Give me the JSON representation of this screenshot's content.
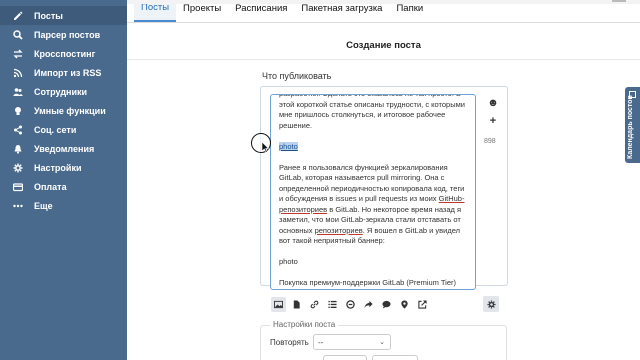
{
  "sidebar": {
    "items": [
      {
        "label": "Посты",
        "icon": "edit-icon",
        "active": true
      },
      {
        "label": "Парсер постов",
        "icon": "search-icon",
        "active": false
      },
      {
        "label": "Кросспостинг",
        "icon": "exchange-icon",
        "active": false
      },
      {
        "label": "Импорт из RSS",
        "icon": "rss-icon",
        "active": false
      },
      {
        "label": "Сотрудники",
        "icon": "users-icon",
        "active": false
      },
      {
        "label": "Умные функции",
        "icon": "bulb-icon",
        "active": false
      },
      {
        "label": "Соц. сети",
        "icon": "share-icon",
        "active": false
      },
      {
        "label": "Уведомления",
        "icon": "bell-icon",
        "active": false
      },
      {
        "label": "Настройки",
        "icon": "gear-icon",
        "active": false
      },
      {
        "label": "Оплата",
        "icon": "card-icon",
        "active": false
      },
      {
        "label": "Еще",
        "icon": "more-icon",
        "active": false
      }
    ]
  },
  "tabs": [
    {
      "label": "Посты",
      "active": true
    },
    {
      "label": "Проекты",
      "active": false
    },
    {
      "label": "Расписания",
      "active": false
    },
    {
      "label": "Пакетная загрузка",
      "active": false
    },
    {
      "label": "Папки",
      "active": false
    }
  ],
  "page_title": "Создание поста",
  "publish_label": "Что публиковать",
  "editor": {
    "text_top": "разработки. Сделать это оказалось не так просто. В этой короткой статье описаны трудности, с которыми мне пришлось столкнуться, и итоговое рабочее решение.",
    "photo_selected": "photo",
    "para2_a": "Ранее я пользовался функцией зеркалирования GitLab, которая называется pull mirroring. Она с определенной периодичностью копировала код, теги и обсуждения в issues и pull requests из моих ",
    "para2_link1": "GitHub-репозиториев",
    "para2_b": " в GitLab. Но некоторое время назад я заметил, что мои GitLab-зеркала стали отставать от основных ",
    "para2_link2": "репозиториев",
    "para2_c": ". Я вошел в GitLab и увидел вот такой неприятный баннер:",
    "photo2": "photo",
    "para3": "Покупка премиум-поддержки GitLab (Premium Tier) невозможна в России. GitLab запрещает использовать",
    "char_counter": "898",
    "emoji_icon": "smile-icon",
    "add_icon": "plus-icon"
  },
  "toolbar": [
    "image-icon",
    "file-icon",
    "link-icon",
    "list-icon",
    "poll-icon",
    "forward-icon",
    "comment-icon",
    "location-icon",
    "external-icon"
  ],
  "settings": {
    "legend": "Настройки поста",
    "repeat_label": "Повторять",
    "repeat_value": "--"
  },
  "calendar_tab": "Календарь постов",
  "colors": {
    "sidebar": "#4a6a8d",
    "accent": "#2a6fb0",
    "highlight": "#b8d3f0"
  }
}
